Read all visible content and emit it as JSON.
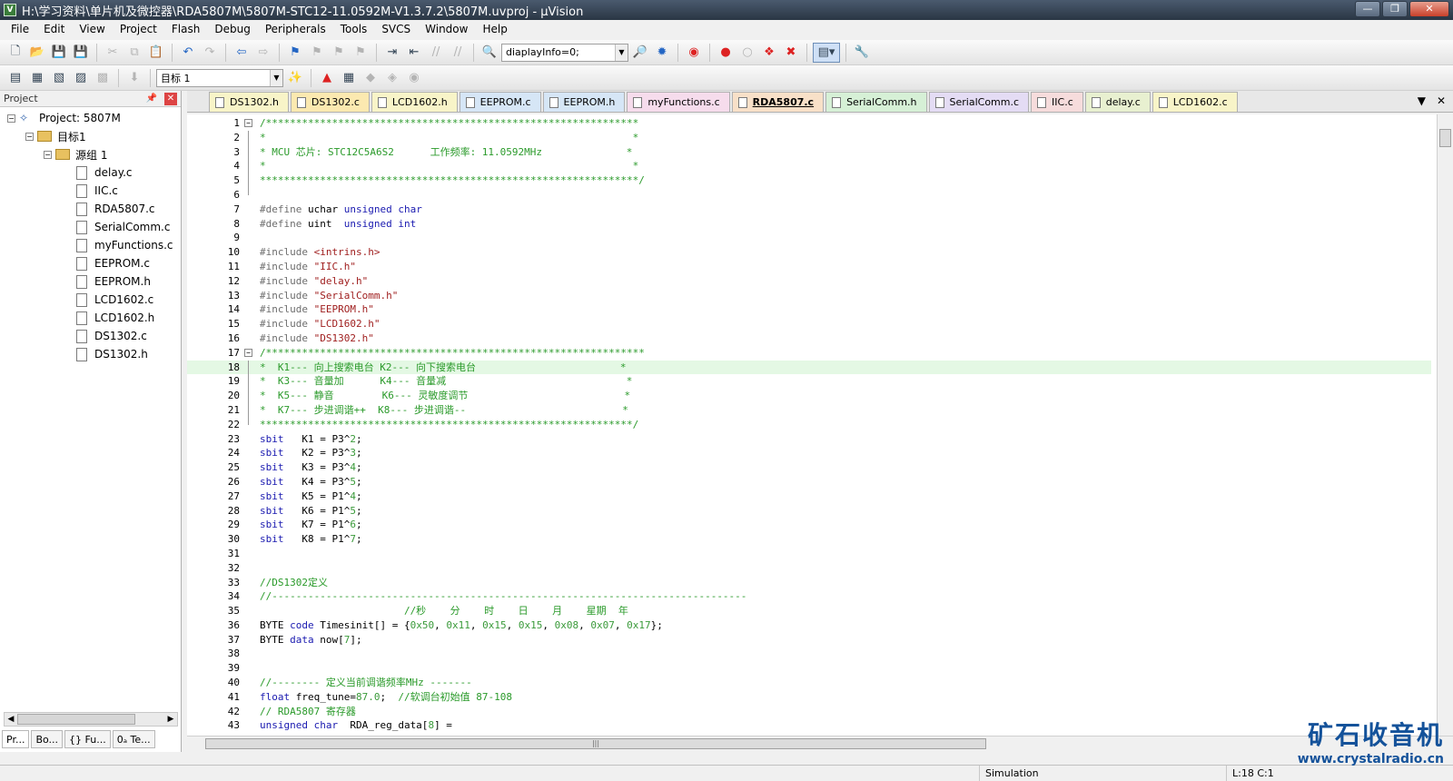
{
  "window": {
    "title": "H:\\学习资料\\单片机及微控器\\RDA5807M\\5807M-STC12-11.0592M-V1.3.7.2\\5807M.uvproj - µVision",
    "app_icon": "V"
  },
  "menu": [
    "File",
    "Edit",
    "View",
    "Project",
    "Flash",
    "Debug",
    "Peripherals",
    "Tools",
    "SVCS",
    "Window",
    "Help"
  ],
  "toolbar": {
    "find_combo_value": "diaplayInfo=0;",
    "target_combo_value": "目标 1"
  },
  "project_pane": {
    "header": "Project",
    "root": "Project: 5807M",
    "target": "目标1",
    "group": "源组 1",
    "files": [
      "delay.c",
      "IIC.c",
      "RDA5807.c",
      "SerialComm.c",
      "myFunctions.c",
      "EEPROM.c",
      "EEPROM.h",
      "LCD1602.c",
      "LCD1602.h",
      "DS1302.c",
      "DS1302.h"
    ],
    "bottom_tabs": [
      "Pr...",
      "Bo...",
      "{} Fu...",
      "0ₐ Te..."
    ]
  },
  "editor_tabs": [
    {
      "label": "DS1302.h",
      "color": "#f8f4c8"
    },
    {
      "label": "DS1302.c",
      "color": "#fbe9b0"
    },
    {
      "label": "LCD1602.h",
      "color": "#f8f4c8"
    },
    {
      "label": "EEPROM.c",
      "color": "#d6e6f6"
    },
    {
      "label": "EEPROM.h",
      "color": "#d6e6f6"
    },
    {
      "label": "myFunctions.c",
      "color": "#f6dcec"
    },
    {
      "label": "RDA5807.c",
      "color": "#f8e0c8",
      "active": true
    },
    {
      "label": "SerialComm.h",
      "color": "#d6f0d6"
    },
    {
      "label": "SerialComm.c",
      "color": "#e4dcf4"
    },
    {
      "label": "IIC.c",
      "color": "#f6dcdc"
    },
    {
      "label": "delay.c",
      "color": "#e8f0d0"
    },
    {
      "label": "LCD1602.c",
      "color": "#f8f4c8"
    }
  ],
  "code": [
    {
      "n": "1",
      "fold": "box",
      "t": [
        [
          "c-cm",
          "/**************************************************************"
        ]
      ]
    },
    {
      "n": "2",
      "fold": "line",
      "t": [
        [
          "c-cm",
          "*                                                             *"
        ]
      ]
    },
    {
      "n": "3",
      "fold": "line",
      "t": [
        [
          "c-cm",
          "* MCU 芯片: STC12C5A6S2      工作频率: 11.0592MHz              *"
        ]
      ]
    },
    {
      "n": "4",
      "fold": "line",
      "t": [
        [
          "c-cm",
          "*                                                             *"
        ]
      ]
    },
    {
      "n": "5",
      "fold": "line",
      "t": [
        [
          "c-cm",
          "***************************************************************/"
        ]
      ]
    },
    {
      "n": "6",
      "fold": "end",
      "t": [
        [
          "",
          ""
        ]
      ]
    },
    {
      "n": "7",
      "t": [
        [
          "c-pp",
          "#define "
        ],
        [
          "",
          "uchar "
        ],
        [
          "c-kw",
          "unsigned char"
        ]
      ]
    },
    {
      "n": "8",
      "t": [
        [
          "c-pp",
          "#define "
        ],
        [
          "",
          "uint  "
        ],
        [
          "c-kw",
          "unsigned int"
        ]
      ]
    },
    {
      "n": "9",
      "t": [
        [
          "",
          ""
        ]
      ]
    },
    {
      "n": "10",
      "t": [
        [
          "c-pp",
          "#include "
        ],
        [
          "c-str",
          "<intrins.h>"
        ]
      ]
    },
    {
      "n": "11",
      "t": [
        [
          "c-pp",
          "#include "
        ],
        [
          "c-str",
          "\"IIC.h\""
        ]
      ]
    },
    {
      "n": "12",
      "t": [
        [
          "c-pp",
          "#include "
        ],
        [
          "c-str",
          "\"delay.h\""
        ]
      ]
    },
    {
      "n": "13",
      "t": [
        [
          "c-pp",
          "#include "
        ],
        [
          "c-str",
          "\"SerialComm.h\""
        ]
      ]
    },
    {
      "n": "14",
      "t": [
        [
          "c-pp",
          "#include "
        ],
        [
          "c-str",
          "\"EEPROM.h\""
        ]
      ]
    },
    {
      "n": "15",
      "t": [
        [
          "c-pp",
          "#include "
        ],
        [
          "c-str",
          "\"LCD1602.h\""
        ]
      ]
    },
    {
      "n": "16",
      "t": [
        [
          "c-pp",
          "#include "
        ],
        [
          "c-str",
          "\"DS1302.h\""
        ]
      ]
    },
    {
      "n": "17",
      "fold": "box",
      "t": [
        [
          "c-cm",
          "/***************************************************************"
        ]
      ]
    },
    {
      "n": "18",
      "fold": "line",
      "hl": true,
      "t": [
        [
          "c-cm",
          "*  K1--- 向上搜索电台 K2--- 向下搜索电台                        *"
        ]
      ]
    },
    {
      "n": "19",
      "fold": "line",
      "t": [
        [
          "c-cm",
          "*  K3--- 音量加      K4--- 音量减                              *"
        ]
      ]
    },
    {
      "n": "20",
      "fold": "line",
      "t": [
        [
          "c-cm",
          "*  K5--- 静音        K6--- 灵敏度调节                          *"
        ]
      ]
    },
    {
      "n": "21",
      "fold": "line",
      "t": [
        [
          "c-cm",
          "*  K7--- 步进调谐++  K8--- 步进调谐--                          *"
        ]
      ]
    },
    {
      "n": "22",
      "fold": "end",
      "t": [
        [
          "c-cm",
          "**************************************************************/"
        ]
      ]
    },
    {
      "n": "23",
      "t": [
        [
          "c-kw",
          "sbit "
        ],
        [
          "",
          "  K1 = P3^"
        ],
        [
          "c-num",
          "2"
        ],
        [
          "",
          ";"
        ]
      ]
    },
    {
      "n": "24",
      "t": [
        [
          "c-kw",
          "sbit "
        ],
        [
          "",
          "  K2 = P3^"
        ],
        [
          "c-num",
          "3"
        ],
        [
          "",
          ";"
        ]
      ]
    },
    {
      "n": "25",
      "t": [
        [
          "c-kw",
          "sbit "
        ],
        [
          "",
          "  K3 = P3^"
        ],
        [
          "c-num",
          "4"
        ],
        [
          "",
          ";"
        ]
      ]
    },
    {
      "n": "26",
      "t": [
        [
          "c-kw",
          "sbit "
        ],
        [
          "",
          "  K4 = P3^"
        ],
        [
          "c-num",
          "5"
        ],
        [
          "",
          ";"
        ]
      ]
    },
    {
      "n": "27",
      "t": [
        [
          "c-kw",
          "sbit "
        ],
        [
          "",
          "  K5 = P1^"
        ],
        [
          "c-num",
          "4"
        ],
        [
          "",
          ";"
        ]
      ]
    },
    {
      "n": "28",
      "t": [
        [
          "c-kw",
          "sbit "
        ],
        [
          "",
          "  K6 = P1^"
        ],
        [
          "c-num",
          "5"
        ],
        [
          "",
          ";"
        ]
      ]
    },
    {
      "n": "29",
      "t": [
        [
          "c-kw",
          "sbit "
        ],
        [
          "",
          "  K7 = P1^"
        ],
        [
          "c-num",
          "6"
        ],
        [
          "",
          ";"
        ]
      ]
    },
    {
      "n": "30",
      "t": [
        [
          "c-kw",
          "sbit "
        ],
        [
          "",
          "  K8 = P1^"
        ],
        [
          "c-num",
          "7"
        ],
        [
          "",
          ";"
        ]
      ]
    },
    {
      "n": "31",
      "t": [
        [
          "",
          ""
        ]
      ]
    },
    {
      "n": "32",
      "t": [
        [
          "",
          ""
        ]
      ]
    },
    {
      "n": "33",
      "t": [
        [
          "c-cm",
          "//DS1302定义"
        ]
      ]
    },
    {
      "n": "34",
      "t": [
        [
          "c-cm",
          "//-------------------------------------------------------------------------------"
        ]
      ]
    },
    {
      "n": "35",
      "t": [
        [
          "c-cm",
          "                        //秒    分    时    日    月    星期  年"
        ]
      ]
    },
    {
      "n": "36",
      "t": [
        [
          "",
          "BYTE "
        ],
        [
          "c-kw",
          "code"
        ],
        [
          "",
          " Timesinit[] = {"
        ],
        [
          "c-num",
          "0x50"
        ],
        [
          "",
          ", "
        ],
        [
          "c-num",
          "0x11"
        ],
        [
          "",
          ", "
        ],
        [
          "c-num",
          "0x15"
        ],
        [
          "",
          ", "
        ],
        [
          "c-num",
          "0x15"
        ],
        [
          "",
          ", "
        ],
        [
          "c-num",
          "0x08"
        ],
        [
          "",
          ", "
        ],
        [
          "c-num",
          "0x07"
        ],
        [
          "",
          ", "
        ],
        [
          "c-num",
          "0x17"
        ],
        [
          "",
          "};"
        ]
      ]
    },
    {
      "n": "37",
      "t": [
        [
          "",
          "BYTE "
        ],
        [
          "c-kw",
          "data"
        ],
        [
          "",
          " now["
        ],
        [
          "c-num",
          "7"
        ],
        [
          "",
          "];"
        ]
      ]
    },
    {
      "n": "38",
      "t": [
        [
          "",
          ""
        ]
      ]
    },
    {
      "n": "39",
      "t": [
        [
          "",
          ""
        ]
      ]
    },
    {
      "n": "40",
      "t": [
        [
          "c-cm",
          "//-------- 定义当前调谐频率MHz -------"
        ]
      ]
    },
    {
      "n": "41",
      "t": [
        [
          "c-kw",
          "float"
        ],
        [
          "",
          " freq_tune="
        ],
        [
          "c-num",
          "87.0"
        ],
        [
          "",
          ";  "
        ],
        [
          "c-cm",
          "//软调台初始值 87-108"
        ]
      ]
    },
    {
      "n": "42",
      "t": [
        [
          "c-cm",
          "// RDA5807 寄存器"
        ]
      ]
    },
    {
      "n": "43",
      "t": [
        [
          "c-kw",
          "unsigned char"
        ],
        [
          "",
          "  RDA_reg_data["
        ],
        [
          "c-num",
          "8"
        ],
        [
          "",
          "] ="
        ]
      ]
    }
  ],
  "statusbar": {
    "mode": "Simulation",
    "cursor": "L:18 C:1"
  },
  "watermark": {
    "logo": "矿石收音机",
    "url": "www.crystalradio.cn"
  }
}
